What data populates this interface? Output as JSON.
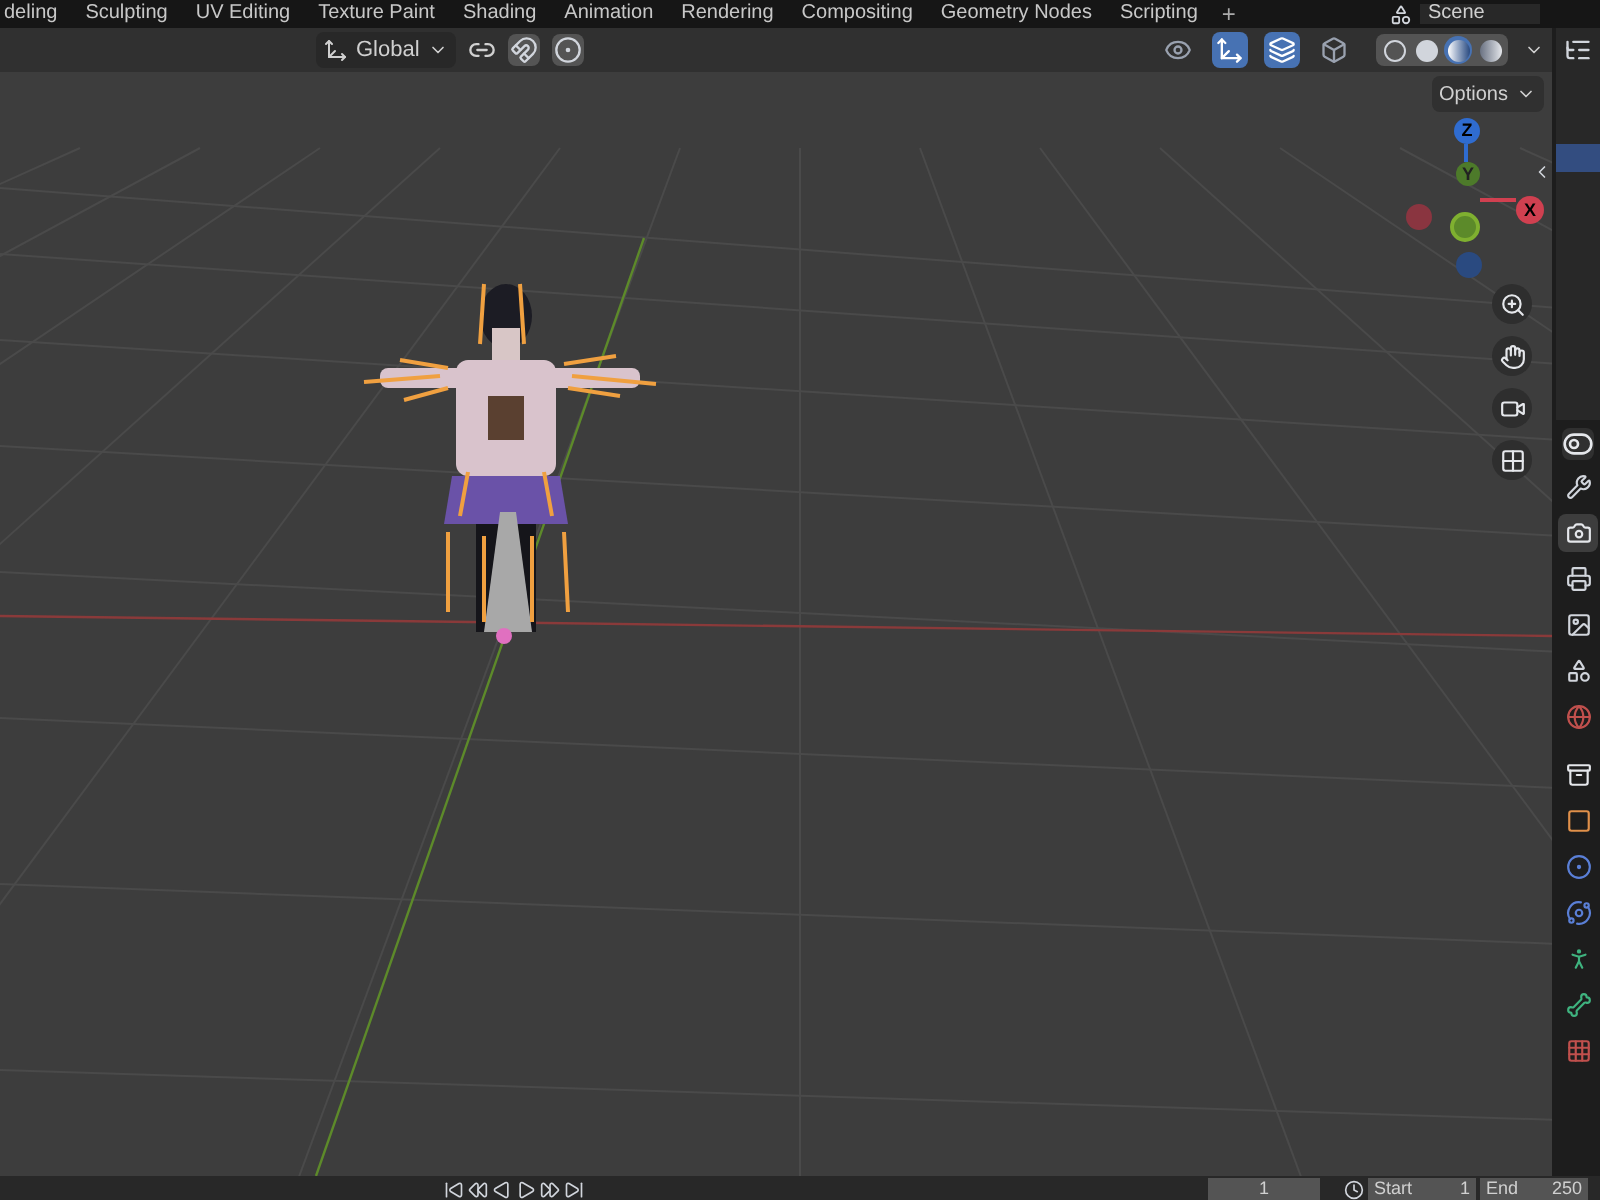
{
  "workspace_tabs": [
    {
      "label": "deling",
      "selected": false
    },
    {
      "label": "Sculpting",
      "selected": false
    },
    {
      "label": "UV Editing",
      "selected": false
    },
    {
      "label": "Texture Paint",
      "selected": false
    },
    {
      "label": "Shading",
      "selected": false
    },
    {
      "label": "Animation",
      "selected": false
    },
    {
      "label": "Rendering",
      "selected": false
    },
    {
      "label": "Compositing",
      "selected": false
    },
    {
      "label": "Geometry Nodes",
      "selected": false
    },
    {
      "label": "Scripting",
      "selected": false
    }
  ],
  "add_tab": "+",
  "scene": "Scene",
  "header": {
    "orientation": "Global",
    "options": "Options"
  },
  "header_toggles": [
    {
      "kind": "snap",
      "on": false
    },
    {
      "kind": "proportional",
      "on": false
    },
    {
      "kind": "visibility",
      "on": false
    },
    {
      "kind": "gizmo",
      "on": true
    },
    {
      "kind": "overlay",
      "on": true
    },
    {
      "kind": "xray",
      "on": false
    }
  ],
  "shading_modes": [
    {
      "kind": "wireframe",
      "selected": false
    },
    {
      "kind": "solid",
      "selected": false
    },
    {
      "kind": "material",
      "selected": true
    },
    {
      "kind": "rendered",
      "selected": false
    }
  ],
  "gizmo": {
    "x": "X",
    "y": "Y",
    "z": "Z"
  },
  "properties_tabs": [
    {
      "kind": "tool",
      "selected": false
    },
    {
      "kind": "render",
      "selected": true
    },
    {
      "kind": "output",
      "selected": false
    },
    {
      "kind": "view_layer",
      "selected": false
    },
    {
      "kind": "scene",
      "selected": false
    },
    {
      "kind": "world",
      "selected": false
    },
    {
      "kind": "collection",
      "selected": false
    },
    {
      "kind": "object",
      "selected": false
    },
    {
      "kind": "modifiers",
      "selected": false
    },
    {
      "kind": "physics",
      "selected": false
    },
    {
      "kind": "pose",
      "selected": false
    },
    {
      "kind": "bone",
      "selected": false
    },
    {
      "kind": "texture",
      "selected": false
    }
  ],
  "timeline": {
    "frame": "1",
    "start_label": "Start",
    "start": "1",
    "end_label": "End",
    "end": "250"
  }
}
